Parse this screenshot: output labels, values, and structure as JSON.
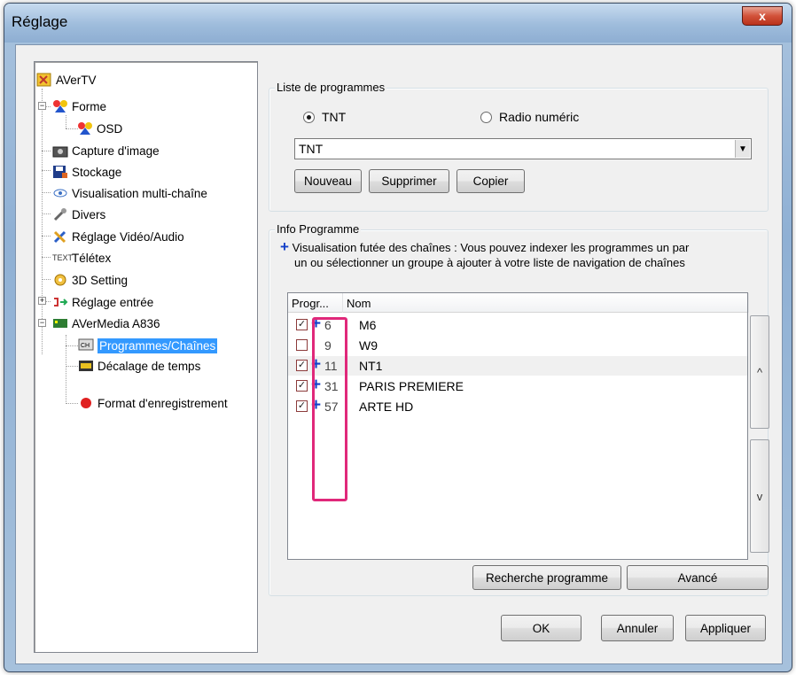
{
  "window": {
    "title": "Réglage",
    "close_label": "x"
  },
  "tree": {
    "items": [
      {
        "label": "AVerTV",
        "icon": "avertv-icon"
      },
      {
        "label": "Forme",
        "icon": "skin-icon"
      },
      {
        "label": "OSD",
        "icon": "osd-icon"
      },
      {
        "label": "Capture d'image",
        "icon": "camera-icon"
      },
      {
        "label": "Stockage",
        "icon": "save-icon"
      },
      {
        "label": "Visualisation multi-chaîne",
        "icon": "eye-icon"
      },
      {
        "label": "Divers",
        "icon": "wrench-icon"
      },
      {
        "label": "Réglage Vidéo/Audio",
        "icon": "tools-icon"
      },
      {
        "label": "Télétex",
        "icon": "teletext-icon"
      },
      {
        "label": "3D Setting",
        "icon": "gear-3d-icon"
      },
      {
        "label": "Réglage entrée",
        "icon": "input-icon"
      },
      {
        "label": "AVerMedia A836",
        "icon": "device-icon"
      },
      {
        "label": "Programmes/Chaînes",
        "icon": "channel-icon"
      },
      {
        "label": "Décalage de temps",
        "icon": "timeshift-icon"
      },
      {
        "label": "Format d'enregistrement",
        "icon": "record-icon"
      }
    ],
    "selected": "Programmes/Chaînes"
  },
  "program_list": {
    "title": "Liste de programmes",
    "radio_tnt": "TNT",
    "radio_radio": "Radio numéric",
    "selected_radio": "TNT",
    "combo_value": "TNT",
    "btn_new": "Nouveau",
    "btn_delete": "Supprimer",
    "btn_copy": "Copier"
  },
  "program_info": {
    "title": "Info Programme",
    "hint_line1": "Visualisation futée des chaînes : Vous pouvez indexer les programmes un par",
    "hint_line2": "un ou sélectionner un groupe à ajouter à votre liste de navigation de chaînes",
    "columns": [
      "Progr...",
      "Nom"
    ],
    "rows": [
      {
        "num": "6",
        "name": "M6",
        "checked": true,
        "plus": true
      },
      {
        "num": "9",
        "name": "W9",
        "checked": false,
        "plus": false
      },
      {
        "num": "11",
        "name": "NT1",
        "checked": true,
        "plus": true
      },
      {
        "num": "31",
        "name": "PARIS PREMIERE",
        "checked": true,
        "plus": true
      },
      {
        "num": "57",
        "name": "ARTE HD",
        "checked": true,
        "plus": true
      }
    ],
    "scroll_up": "^",
    "scroll_down": "v",
    "btn_scan": "Recherche programme",
    "btn_advanced": "Avancé"
  },
  "footer": {
    "ok": "OK",
    "cancel": "Annuler",
    "apply": "Appliquer"
  },
  "colors": {
    "highlight": "#e0287a",
    "selection": "#3399ff",
    "plus": "#1340c8"
  }
}
